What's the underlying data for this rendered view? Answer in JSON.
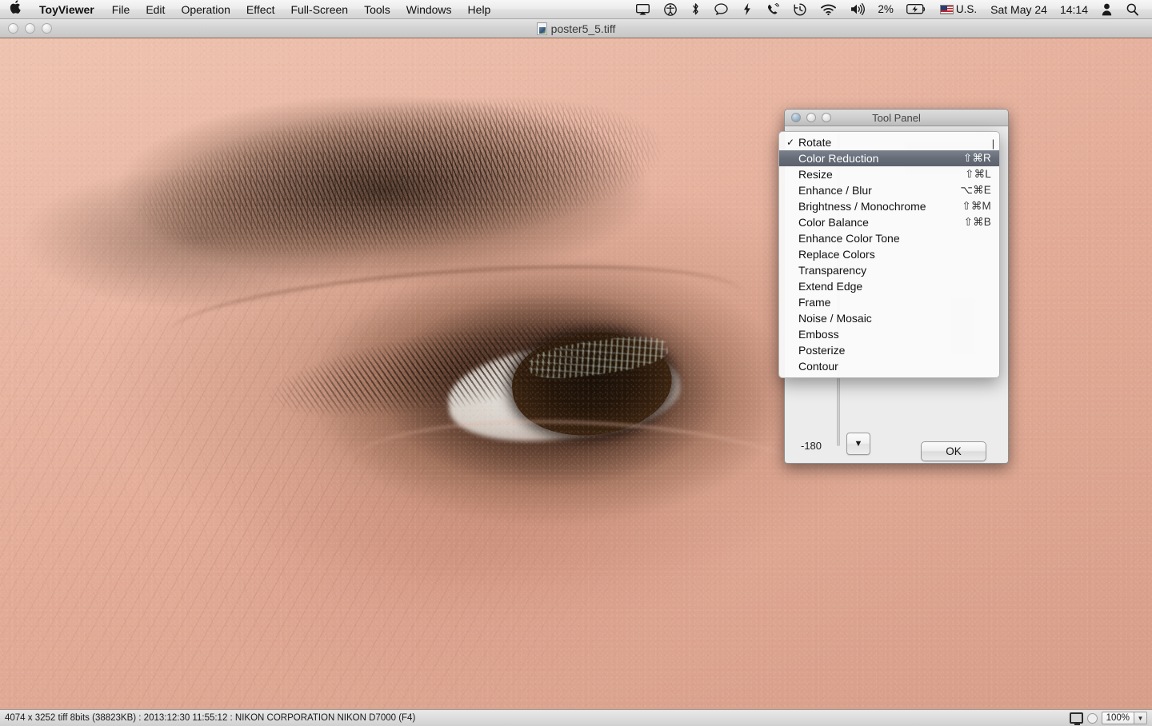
{
  "menubar": {
    "apple_icon": "apple-logo",
    "app_name": "ToyViewer",
    "items": [
      "File",
      "Edit",
      "Operation",
      "Effect",
      "Full-Screen",
      "Tools",
      "Windows",
      "Help"
    ],
    "status_icons": [
      "airplay-icon",
      "accessibility-icon",
      "bluetooth-icon",
      "messages-icon",
      "flash-icon",
      "phone-icon",
      "time-machine-icon",
      "wifi-icon",
      "volume-icon"
    ],
    "battery_percent": "2%",
    "battery_icon": "battery-charging-icon",
    "input_flag": "us-flag-icon",
    "input_label": "U.S.",
    "date": "Sat May 24",
    "time": "14:14",
    "user_icon": "user-account-icon",
    "search_icon": "spotlight-search-icon"
  },
  "window": {
    "title": "poster5_5.tiff",
    "doc_icon": "tiff-document-icon",
    "traffic_lights": [
      "close-button",
      "minimize-button",
      "zoom-button"
    ]
  },
  "statusbar": {
    "info": "4074 x 3252  tiff  8bits (38823KB) : 2013:12:30 11:55:12 : NIKON CORPORATION NIKON D7000 (F4)",
    "monitor_icon": "display-fit-icon",
    "toggle_icon": "secondary-toggle",
    "zoom_level": "100%",
    "zoom_arrow": "▼"
  },
  "toolpanel": {
    "title": "Tool Panel",
    "traffic_lights": [
      "close-button",
      "minimize-button",
      "zoom-button"
    ],
    "min_label": "-180",
    "step_down_label": "▼",
    "ok_label": "OK"
  },
  "dropdown": {
    "scroll_indicator": "|",
    "items": [
      {
        "label": "Rotate",
        "shortcut": "",
        "checked": true,
        "selected": false
      },
      {
        "label": "Color Reduction",
        "shortcut": "⇧⌘R",
        "checked": false,
        "selected": true
      },
      {
        "label": "Resize",
        "shortcut": "⇧⌘L",
        "checked": false,
        "selected": false
      },
      {
        "label": "Enhance / Blur",
        "shortcut": "⌥⌘E",
        "checked": false,
        "selected": false
      },
      {
        "label": "Brightness / Monochrome",
        "shortcut": "⇧⌘M",
        "checked": false,
        "selected": false
      },
      {
        "label": "Color Balance",
        "shortcut": "⇧⌘B",
        "checked": false,
        "selected": false
      },
      {
        "label": "Enhance Color Tone",
        "shortcut": "",
        "checked": false,
        "selected": false
      },
      {
        "label": "Replace Colors",
        "shortcut": "",
        "checked": false,
        "selected": false
      },
      {
        "label": "Transparency",
        "shortcut": "",
        "checked": false,
        "selected": false
      },
      {
        "label": "Extend Edge",
        "shortcut": "",
        "checked": false,
        "selected": false
      },
      {
        "label": "Frame",
        "shortcut": "",
        "checked": false,
        "selected": false
      },
      {
        "label": "Noise / Mosaic",
        "shortcut": "",
        "checked": false,
        "selected": false
      },
      {
        "label": "Emboss",
        "shortcut": "",
        "checked": false,
        "selected": false
      },
      {
        "label": "Posterize",
        "shortcut": "",
        "checked": false,
        "selected": false
      },
      {
        "label": "Contour",
        "shortcut": "",
        "checked": false,
        "selected": false
      }
    ]
  },
  "photo": {
    "subject": "close-up-photograph-of-human-eye-and-eyebrow"
  },
  "colors": {
    "menubar_bg": "#ebebeb",
    "selection": "#666d79",
    "panel_bg": "#ececec",
    "skin": "#e3ab99",
    "iris": "#241509"
  }
}
